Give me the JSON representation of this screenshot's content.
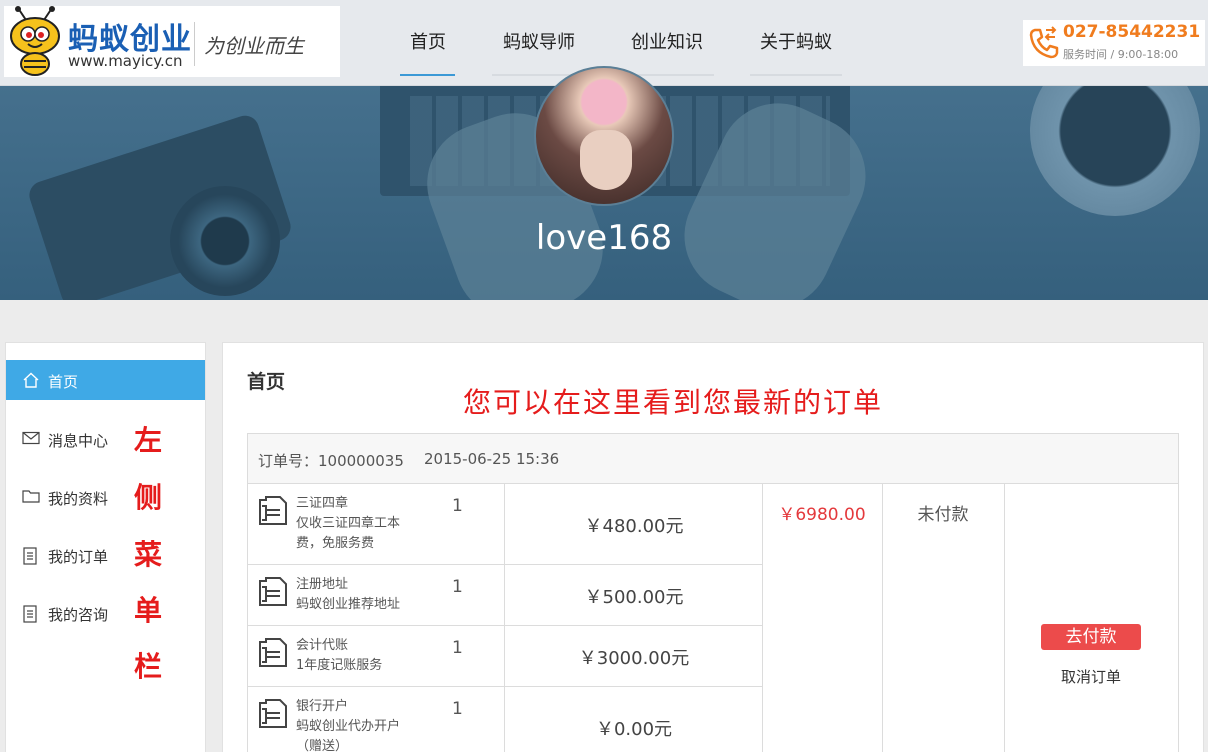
{
  "header": {
    "brand_name": "蚂蚁创业",
    "brand_url": "www.mayicy.cn",
    "slogan": "为创业而生",
    "nav": [
      {
        "label": "首页",
        "active": true
      },
      {
        "label": "蚂蚁导师",
        "active": false
      },
      {
        "label": "创业知识",
        "active": false
      },
      {
        "label": "关于蚂蚁",
        "active": false
      }
    ],
    "phone": "027-85442231",
    "hours": "服务时间 / 9:00-18:00",
    "accent_color": "#3b99d6",
    "phone_color": "#f07c1e"
  },
  "banner": {
    "username": "love168"
  },
  "sidebar": {
    "items": [
      {
        "label": "首页",
        "icon": "home-icon",
        "active": true
      },
      {
        "label": "消息中心",
        "icon": "mail-icon",
        "active": false
      },
      {
        "label": "我的资料",
        "icon": "folder-icon",
        "active": false
      },
      {
        "label": "我的订单",
        "icon": "document-icon",
        "active": false
      },
      {
        "label": "我的咨询",
        "icon": "document-icon",
        "active": false
      }
    ],
    "annotation": [
      "左",
      "侧",
      "菜",
      "单",
      "栏"
    ],
    "active_color": "#3fa9e6"
  },
  "main": {
    "title": "首页",
    "annotation": "您可以在这里看到您最新的订单",
    "order": {
      "order_no": "订单号：100000035",
      "time": "2015-06-25 15:36",
      "items": [
        {
          "name_lines": [
            "三证四章",
            "仅收三证四章工本",
            "费，免服务费"
          ],
          "qty": "1",
          "price": "￥480.00元"
        },
        {
          "name_lines": [
            "注册地址",
            "蚂蚁创业推荐地址"
          ],
          "qty": "1",
          "price": "￥500.00元"
        },
        {
          "name_lines": [
            "会计代账",
            "1年度记账服务"
          ],
          "qty": "1",
          "price": "￥3000.00元"
        },
        {
          "name_lines": [
            "银行开户",
            "蚂蚁创业代办开户",
            "（赠送）"
          ],
          "qty": "1",
          "price": "￥0.00元"
        }
      ],
      "total": "￥6980.00",
      "status": "未付款",
      "pay_label": "去付款",
      "cancel_label": "取消订单",
      "total_color": "#e4393c",
      "pay_color": "#ec4b4b"
    }
  }
}
